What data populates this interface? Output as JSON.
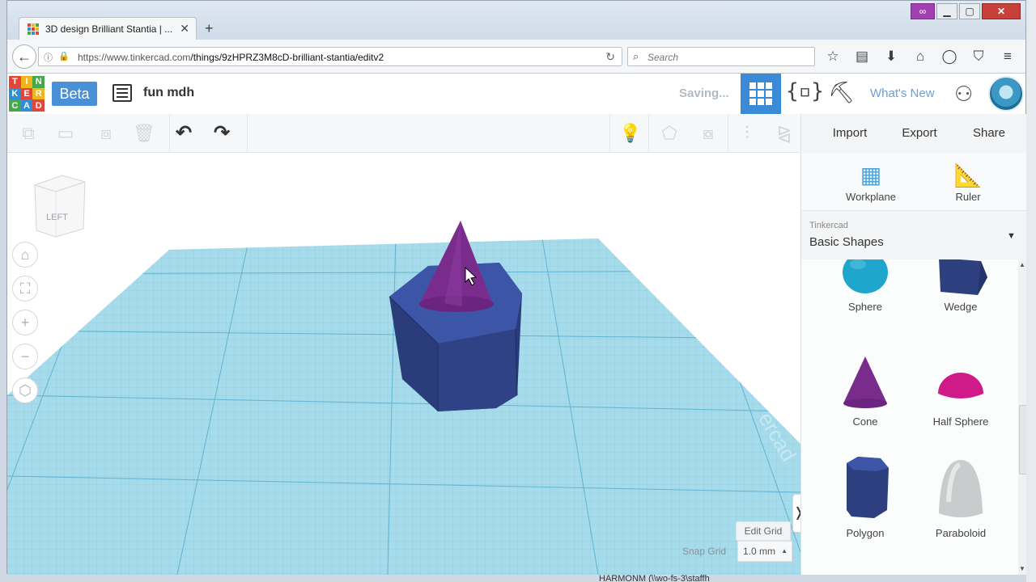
{
  "browser": {
    "tab_title": "3D design Brilliant Stantia | ...",
    "url_host": "https://www.tinkercad.com",
    "url_path": "/things/9zHPRZ3M8cD-brilliant-stantia/editv2",
    "search_placeholder": "Search"
  },
  "header": {
    "logo_letters": [
      "T",
      "I",
      "N",
      "K",
      "E",
      "R",
      "C",
      "A",
      "D"
    ],
    "beta_label": "Beta",
    "design_name": "fun mdh",
    "saving_status": "Saving...",
    "whats_new": "What's New"
  },
  "actions": {
    "import": "Import",
    "export": "Export",
    "share": "Share"
  },
  "panel": {
    "workplane": "Workplane",
    "ruler": "Ruler",
    "library_source": "Tinkercad",
    "library_name": "Basic Shapes",
    "shapes": [
      "Sphere",
      "Wedge",
      "Cone",
      "Half Sphere",
      "Polygon",
      "Paraboloid"
    ]
  },
  "viewport": {
    "view_cube_face": "LEFT",
    "edit_grid": "Edit Grid",
    "snap_grid_label": "Snap Grid",
    "snap_grid_value": "1.0 mm"
  },
  "taskbar_text": "HARMONM (\\\\wo-fs-3\\staffh",
  "colors": {
    "accent": "#3a8ad6",
    "workplane": "#9fd6e8",
    "polygon": "#2e3f7f",
    "cone": "#7a2c8c",
    "sphere": "#1fa6cc",
    "half_sphere": "#d01a8a"
  }
}
